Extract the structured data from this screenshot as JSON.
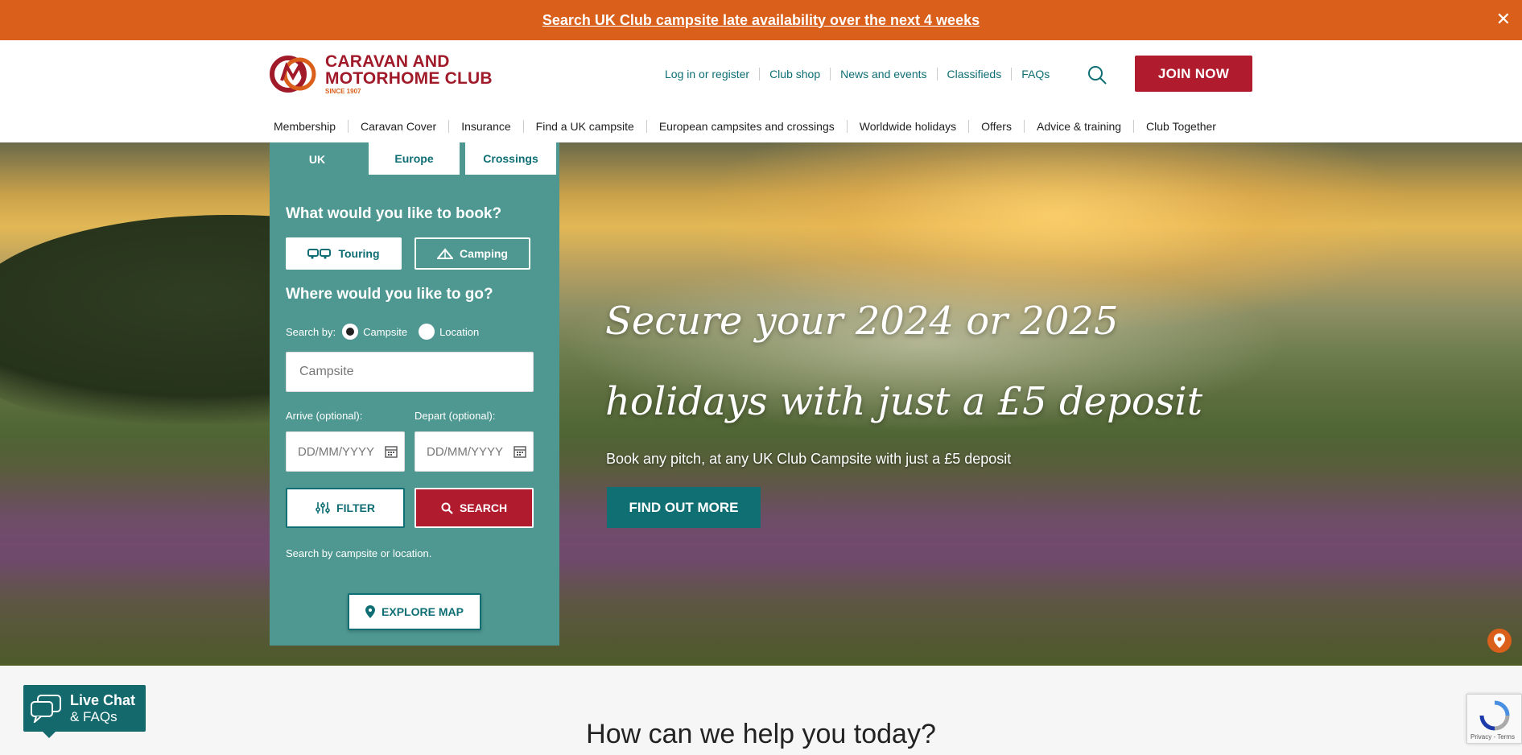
{
  "banner": {
    "link_text": "Search UK Club campsite late availability over the next 4 weeks",
    "close": "✕"
  },
  "logo": {
    "line1": "CARAVAN AND",
    "line2": "MOTORHOME CLUB",
    "since": "SINCE 1907"
  },
  "utility_nav": [
    "Log in or register",
    "Club shop",
    "News and events",
    "Classifieds",
    "FAQs"
  ],
  "join_label": "JOIN NOW",
  "main_nav": [
    "Membership",
    "Caravan Cover",
    "Insurance",
    "Find a UK campsite",
    "European campsites and crossings",
    "Worldwide holidays",
    "Offers",
    "Advice & training",
    "Club Together"
  ],
  "booking": {
    "tabs": [
      "UK",
      "Europe",
      "Crossings"
    ],
    "book_heading": "What would you like to book?",
    "touring_label": "Touring",
    "camping_label": "Camping",
    "go_heading": "Where would you like to go?",
    "search_by_label": "Search by:",
    "option_campsite": "Campsite",
    "option_location": "Location",
    "selected_option": "Campsite",
    "campsite_placeholder": "Campsite",
    "arrive_label": "Arrive (optional):",
    "depart_label": "Depart (optional):",
    "date_placeholder": "DD/MM/YYYY",
    "filter_label": "FILTER",
    "search_label": "SEARCH",
    "hint": "Search by campsite or location.",
    "map_label": "EXPLORE MAP"
  },
  "hero": {
    "title": "Secure your 2024 or 2025 holidays with just a £5 deposit",
    "subtitle": "Book any pitch, at any UK Club Campsite with just a £5 deposit",
    "cta": "FIND OUT MORE"
  },
  "help_heading": "How can we help you today?",
  "live_chat": {
    "line1": "Live Chat",
    "line2": "& FAQs"
  },
  "recaptcha": {
    "text": "Privacy - Terms"
  },
  "colors": {
    "brand_red": "#b01c2e",
    "brand_orange": "#d95f1a",
    "teal": "#0e6e73",
    "panel_teal": "#4e9891"
  }
}
